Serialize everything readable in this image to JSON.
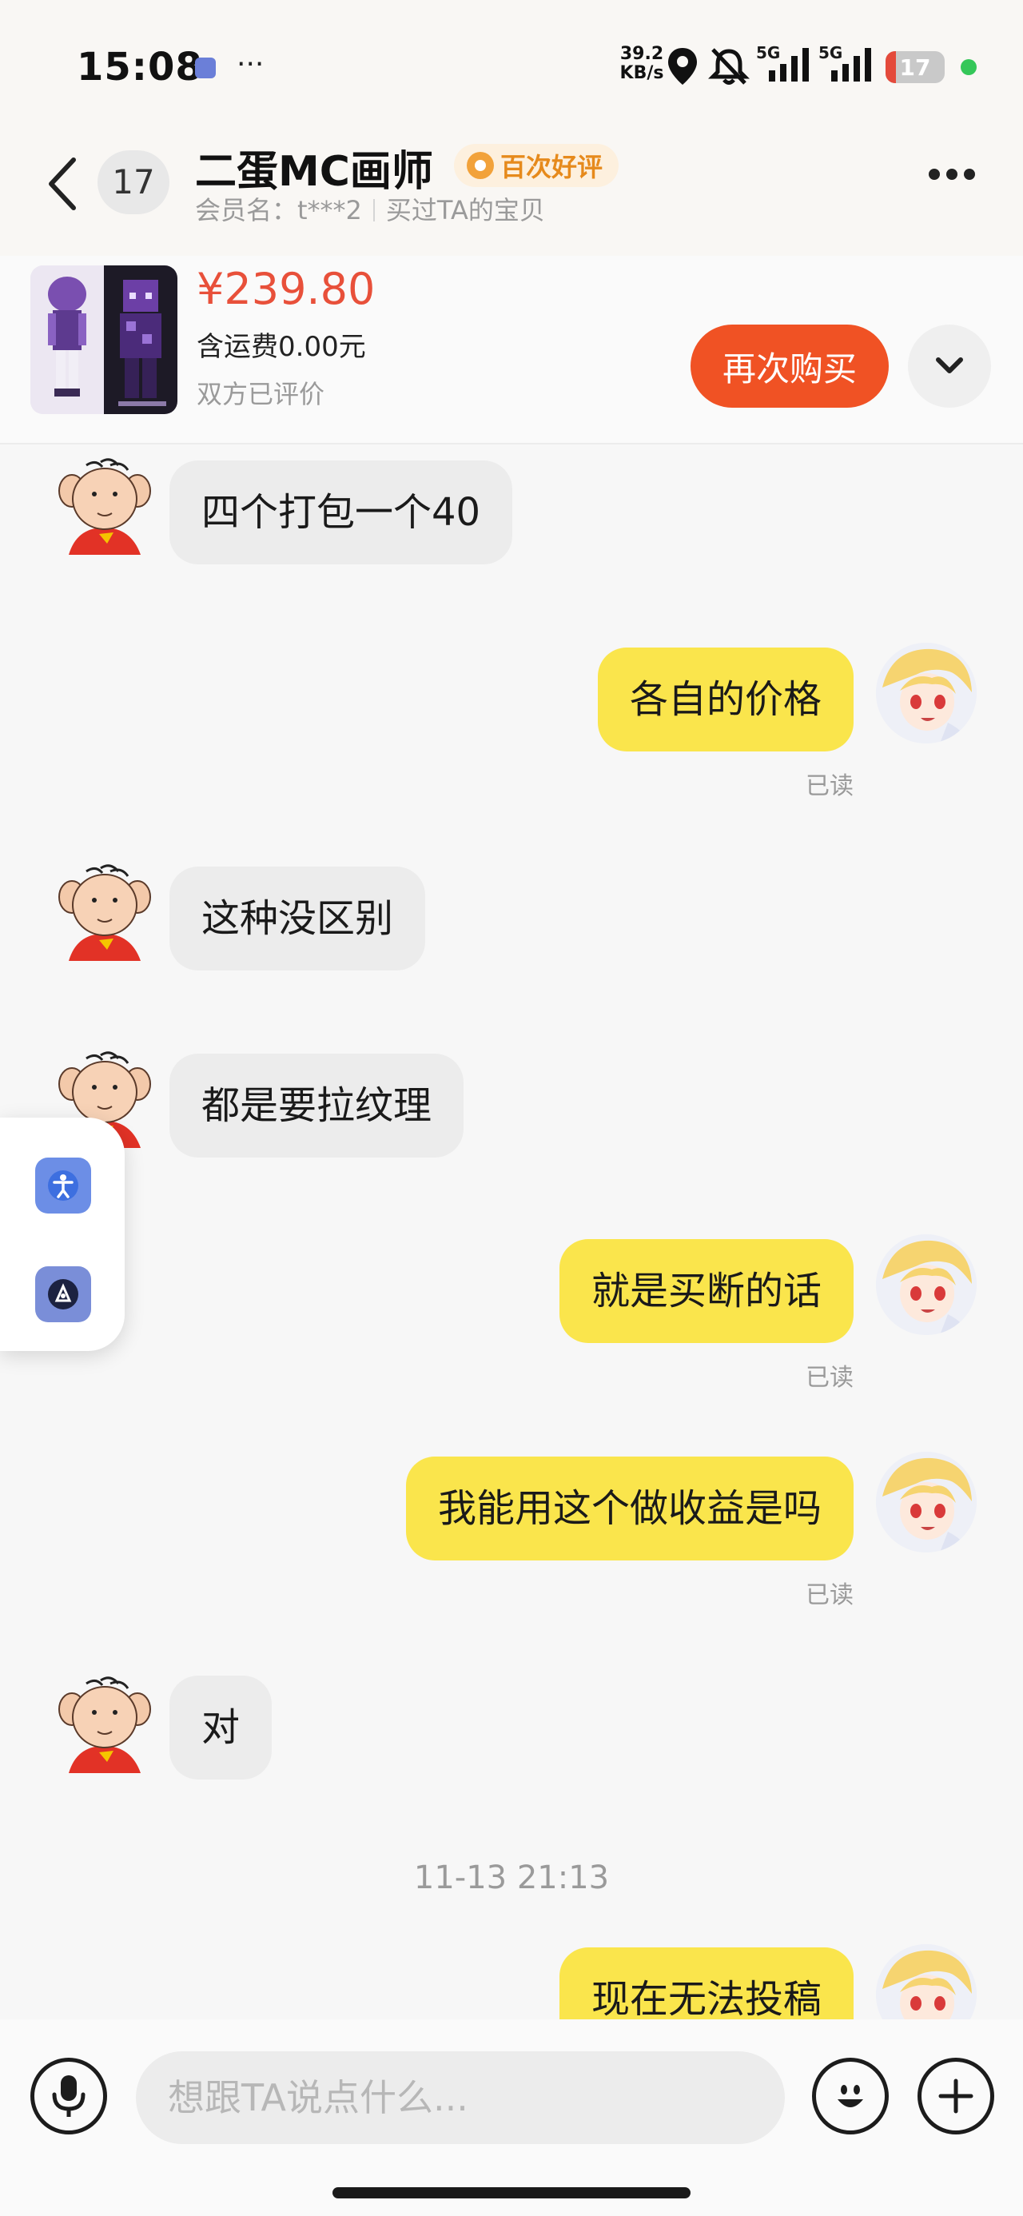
{
  "status_bar": {
    "time": "15:08",
    "more": "···",
    "net_speed_value": "39.2",
    "net_speed_unit": "KB/s",
    "signal_1_label": "5G",
    "signal_2_label": "5G",
    "battery_level": "17",
    "battery_fraction": 0.17,
    "battery_color": "#e44a3b",
    "icons": [
      "location-icon",
      "mute-bell-icon",
      "signal-icon",
      "battery-icon"
    ]
  },
  "header": {
    "unread_count": "17",
    "shop_name": "二蛋MC画师",
    "review_badge": "百次好评",
    "member_label": "会员名：t***2",
    "purchase_note": "买过TA的宝贝"
  },
  "product": {
    "price": "¥239.80",
    "shipping": "含运费0.00元",
    "review_status": "双方已评价",
    "rebuy_label": "再次购买",
    "accent_color": "#f05224"
  },
  "messages": [
    {
      "side": "left",
      "text": "四个打包一个40"
    },
    {
      "side": "right",
      "text": "各自的价格",
      "read": "已读"
    },
    {
      "side": "left",
      "text": "这种没区别"
    },
    {
      "side": "left",
      "text": "都是要拉纹理"
    },
    {
      "side": "right",
      "text": "就是买断的话",
      "read": "已读"
    },
    {
      "side": "right",
      "text": "我能用这个做收益是吗",
      "read": "已读"
    },
    {
      "side": "left",
      "text": "对"
    },
    {
      "side": "right",
      "text": "现在无法投稿"
    }
  ],
  "timestamp": "11-13 21:13",
  "input": {
    "placeholder": "想跟TA说点什么..."
  },
  "colors": {
    "my_bubble": "#fae54c",
    "their_bubble": "#ececec"
  }
}
